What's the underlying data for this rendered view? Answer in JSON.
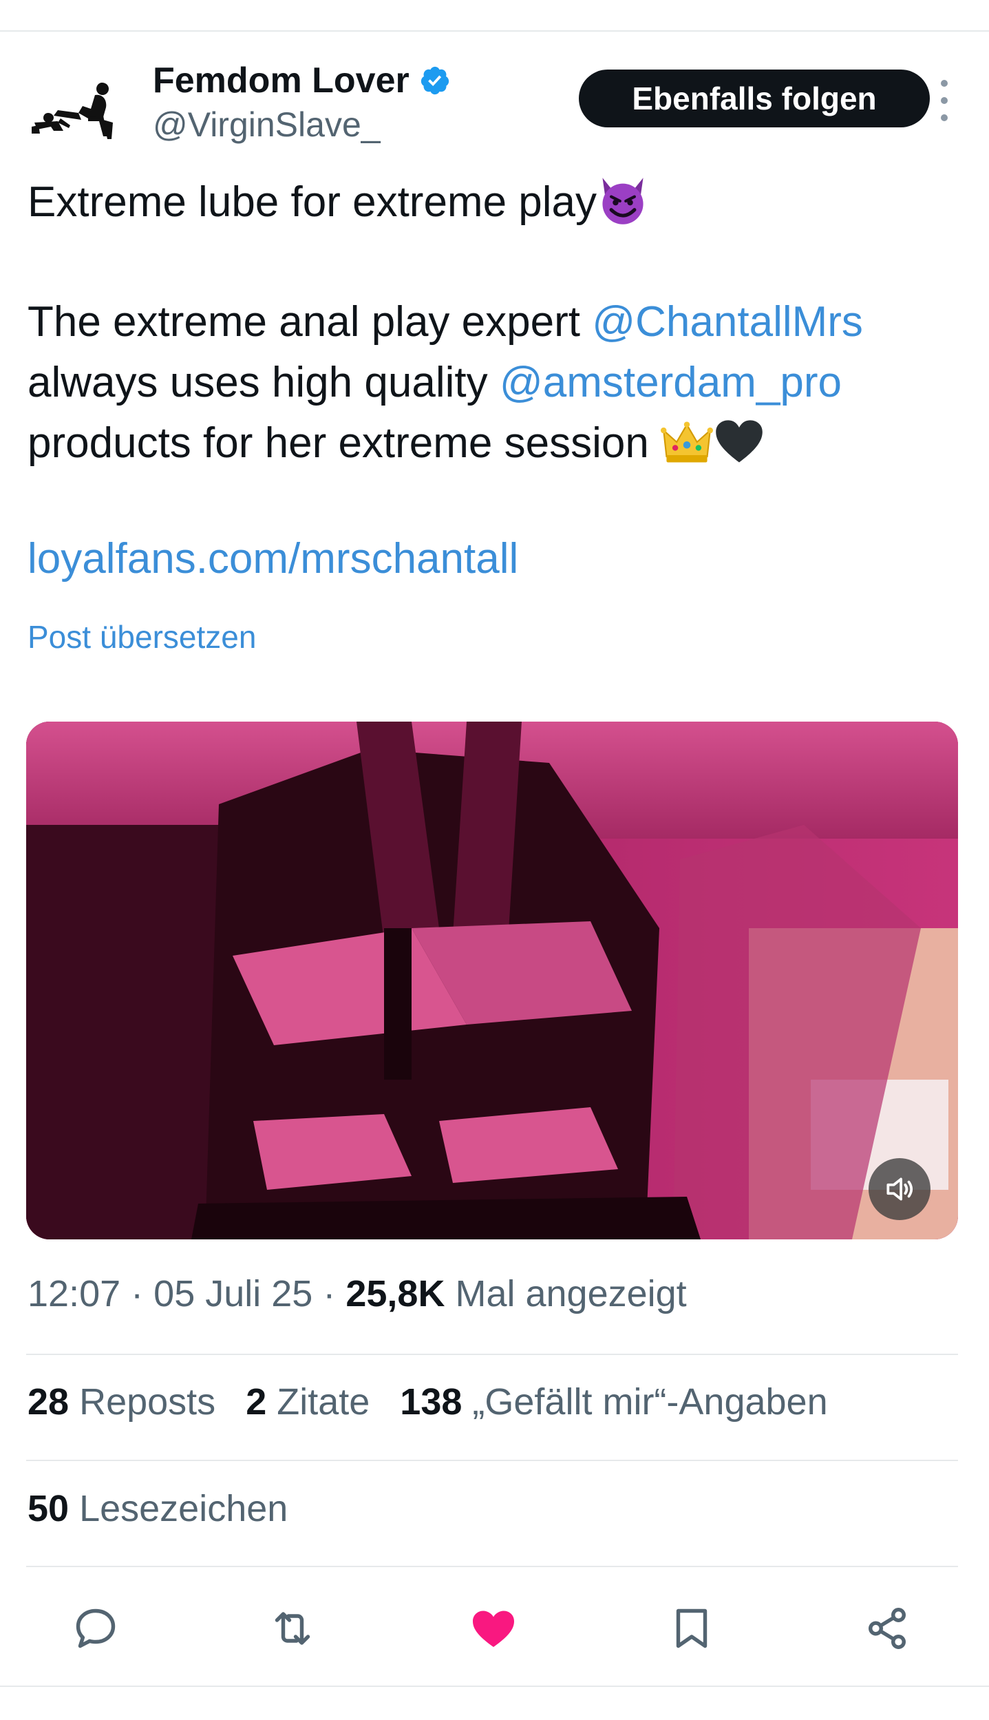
{
  "author": {
    "display_name": "Femdom Lover",
    "handle": "@VirginSlave_",
    "verified": true,
    "follow_label": "Ebenfalls folgen"
  },
  "tweet": {
    "line1_text": "Extreme lube for extreme play",
    "line1_emoji": "smiling-face-with-horns",
    "line2_text": "The extreme anal play expert ",
    "line2_mention": "@ChantallMrs",
    "line3_text": "always uses high quality ",
    "line3_mention": "@amsterdam_pro",
    "line4_text": "products for her extreme session ",
    "line4_emojis": [
      "crown",
      "black-heart"
    ],
    "link": "loyalfans.com/mrschantall",
    "translate_label": "Post übersetzen"
  },
  "media": {
    "type": "video",
    "mute_icon": "speaker-muted-icon"
  },
  "meta": {
    "time": "12:07",
    "separator": "·",
    "date": "05 Juli 25",
    "views_count": "25,8K",
    "views_label": " Mal angezeigt"
  },
  "stats": {
    "reposts_count": "28",
    "reposts_label": " Reposts",
    "quotes_count": "2",
    "quotes_label": " Zitate",
    "likes_count": "138",
    "likes_label": " „Gefällt mir“-Angaben",
    "bookmarks_count": "50",
    "bookmarks_label": " Lesezeichen"
  },
  "actions": [
    {
      "name": "reply",
      "icon": "speech-bubble-icon"
    },
    {
      "name": "repost",
      "icon": "repost-arrows-icon"
    },
    {
      "name": "like",
      "icon": "heart-icon",
      "active": true
    },
    {
      "name": "bookmark",
      "icon": "bookmark-icon"
    },
    {
      "name": "share",
      "icon": "share-nodes-icon"
    }
  ],
  "colors": {
    "text_primary": "#0f1419",
    "text_secondary": "#536471",
    "link": "#3b8ed8",
    "verified": "#1d9bf0",
    "like_active": "#f91880",
    "action_icon": "#536471"
  }
}
